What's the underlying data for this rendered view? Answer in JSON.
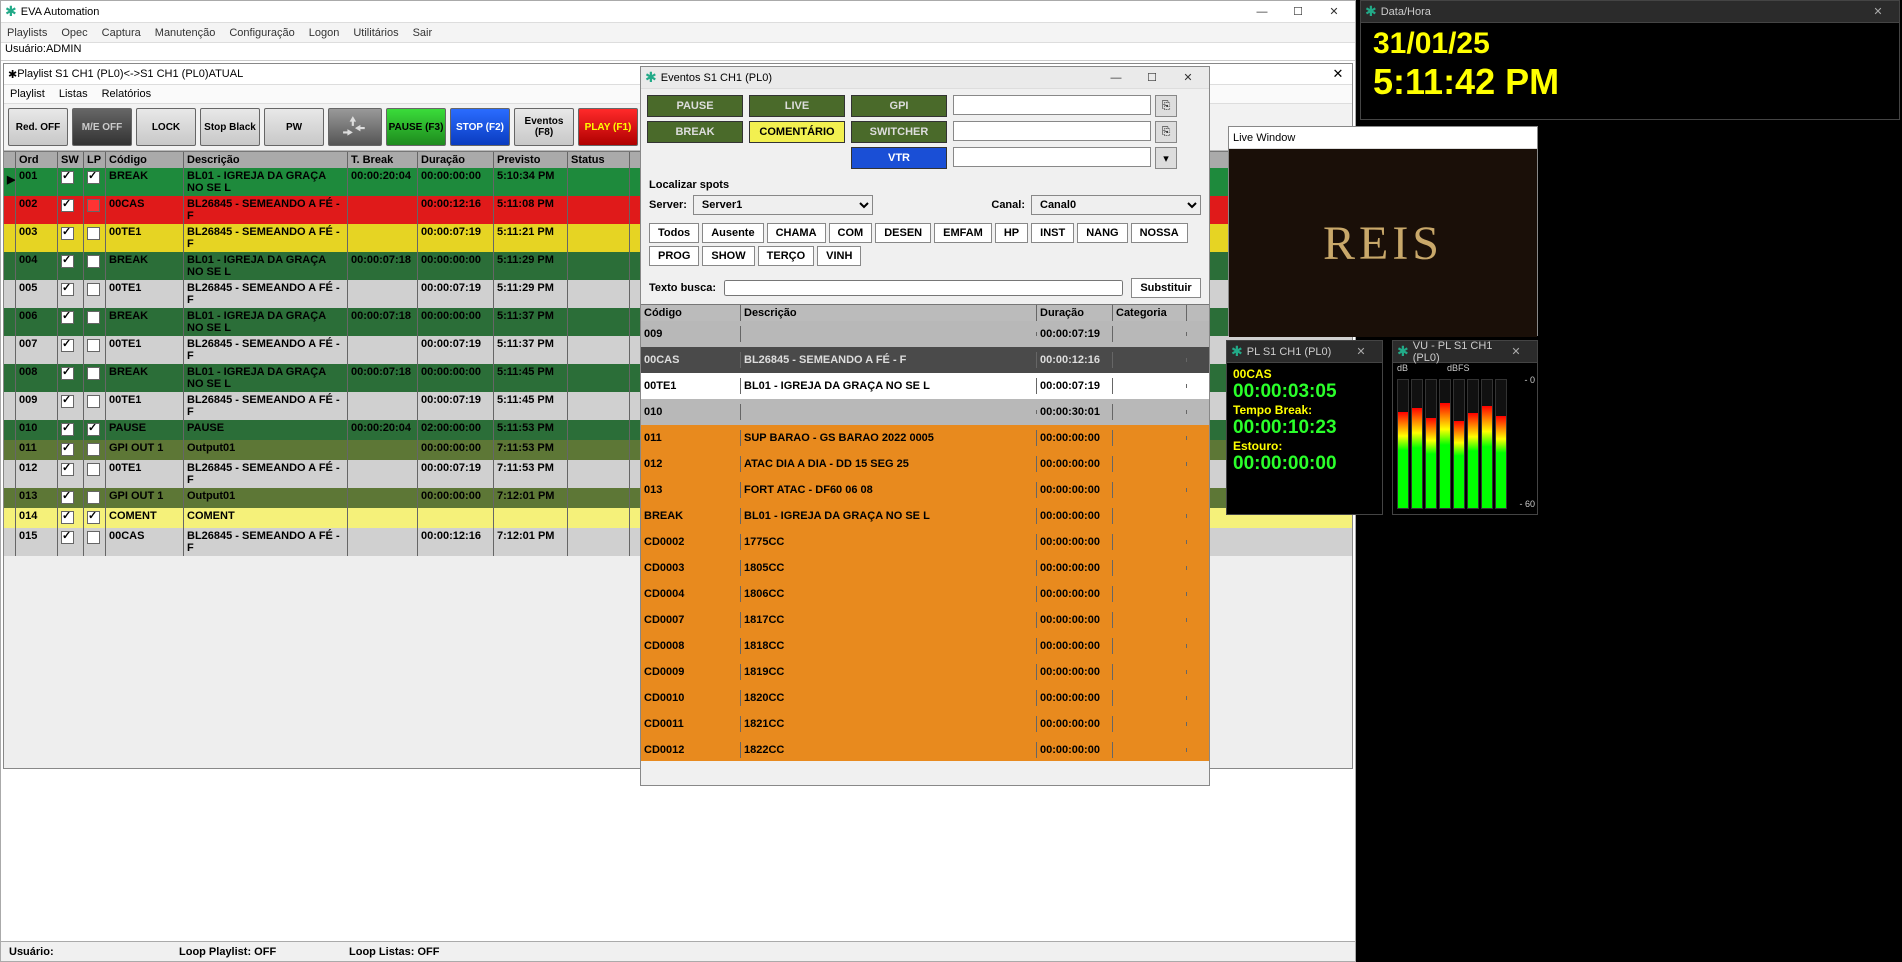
{
  "app": {
    "title": "EVA Automation",
    "menu": [
      "Playlists",
      "Opec",
      "Captura",
      "Manutenção",
      "Configuração",
      "Logon",
      "Utilitários",
      "Sair"
    ],
    "user_label": "Usuário:ADMIN"
  },
  "playlist_window": {
    "title": "Playlist S1 CH1 (PL0)<->S1 CH1 (PL0)ATUAL",
    "menu": [
      "Playlist",
      "Listas",
      "Relatórios"
    ],
    "buttons": {
      "red_off": "Red.\nOFF",
      "me_off": "M/E\nOFF",
      "lock": "LOCK",
      "stop_black": "Stop\nBlack",
      "pw": "PW",
      "pause": "PAUSE\n(F3)",
      "stop": "STOP\n(F2)",
      "eventos": "Eventos\n(F8)",
      "play": "PLAY\n(F1)"
    },
    "headers": {
      "ord": "Ord",
      "sw": "SW",
      "lp": "LP",
      "codigo": "Código",
      "descricao": "Descrição",
      "tbreak": "T. Break",
      "duracao": "Duração",
      "previsto": "Previsto",
      "status": "Status"
    },
    "rows": [
      {
        "ord": "001",
        "sw": true,
        "lp": true,
        "cod": "BREAK",
        "desc": "BL01 - IGREJA DA GRAÇA NO SE L",
        "tb": "00:00:20:04",
        "dur": "00:00:00:00",
        "prev": "5:10:34 PM",
        "cls": "rc-green",
        "h28": true
      },
      {
        "ord": "002",
        "sw": true,
        "lp": false,
        "cod": "00CAS",
        "desc": "BL26845 - SEMEANDO A FÉ - F",
        "tb": "",
        "dur": "00:00:12:16",
        "prev": "5:11:08 PM",
        "cls": "rc-red",
        "h28": true,
        "lpred": true
      },
      {
        "ord": "003",
        "sw": true,
        "lp": false,
        "cod": "00TE1",
        "desc": "BL26845 - SEMEANDO A FÉ - F",
        "tb": "",
        "dur": "00:00:07:19",
        "prev": "5:11:21 PM",
        "cls": "rc-yellow",
        "h28": true
      },
      {
        "ord": "004",
        "sw": true,
        "lp": false,
        "cod": "BREAK",
        "desc": "BL01 - IGREJA DA GRAÇA NO SE L",
        "tb": "00:00:07:18",
        "dur": "00:00:00:00",
        "prev": "5:11:29 PM",
        "cls": "rc-dgreen",
        "h28": true
      },
      {
        "ord": "005",
        "sw": true,
        "lp": false,
        "cod": "00TE1",
        "desc": "BL26845 - SEMEANDO A FÉ - F",
        "tb": "",
        "dur": "00:00:07:19",
        "prev": "5:11:29 PM",
        "cls": "rc-lgray",
        "h28": true
      },
      {
        "ord": "006",
        "sw": true,
        "lp": false,
        "cod": "BREAK",
        "desc": "BL01 - IGREJA DA GRAÇA NO SE L",
        "tb": "00:00:07:18",
        "dur": "00:00:00:00",
        "prev": "5:11:37 PM",
        "cls": "rc-dgreen",
        "h28": true
      },
      {
        "ord": "007",
        "sw": true,
        "lp": false,
        "cod": "00TE1",
        "desc": "BL26845 - SEMEANDO A FÉ - F",
        "tb": "",
        "dur": "00:00:07:19",
        "prev": "5:11:37 PM",
        "cls": "rc-lgray",
        "h28": true
      },
      {
        "ord": "008",
        "sw": true,
        "lp": false,
        "cod": "BREAK",
        "desc": "BL01 - IGREJA DA GRAÇA NO SE L",
        "tb": "00:00:07:18",
        "dur": "00:00:00:00",
        "prev": "5:11:45 PM",
        "cls": "rc-dgreen",
        "h28": true
      },
      {
        "ord": "009",
        "sw": true,
        "lp": false,
        "cod": "00TE1",
        "desc": "BL26845 - SEMEANDO A FÉ - F",
        "tb": "",
        "dur": "00:00:07:19",
        "prev": "5:11:45 PM",
        "cls": "rc-lgray",
        "h28": true
      },
      {
        "ord": "010",
        "sw": true,
        "lp": true,
        "cod": "PAUSE",
        "desc": "PAUSE",
        "tb": "00:00:20:04",
        "dur": "02:00:00:00",
        "prev": "5:11:53 PM",
        "cls": "rc-dgreen"
      },
      {
        "ord": "011",
        "sw": true,
        "lp": false,
        "cod": "GPI OUT 1",
        "desc": "Output01",
        "tb": "",
        "dur": "00:00:00:00",
        "prev": "7:11:53 PM",
        "cls": "rc-olive"
      },
      {
        "ord": "012",
        "sw": true,
        "lp": false,
        "cod": "00TE1",
        "desc": "BL26845 - SEMEANDO A FÉ - F",
        "tb": "",
        "dur": "00:00:07:19",
        "prev": "7:11:53 PM",
        "cls": "rc-lgray",
        "h28": true
      },
      {
        "ord": "013",
        "sw": true,
        "lp": false,
        "cod": "GPI OUT 1",
        "desc": "Output01",
        "tb": "",
        "dur": "00:00:00:00",
        "prev": "7:12:01 PM",
        "cls": "rc-olive"
      },
      {
        "ord": "014",
        "sw": true,
        "lp": true,
        "cod": "COMENT",
        "desc": "COMENT",
        "tb": "",
        "dur": "",
        "prev": "",
        "cls": "rc-lyellow"
      },
      {
        "ord": "015",
        "sw": true,
        "lp": false,
        "cod": "00CAS",
        "desc": "BL26845 - SEMEANDO A FÉ - F",
        "tb": "",
        "dur": "00:00:12:16",
        "prev": "7:12:01 PM",
        "cls": "rc-lgray",
        "h28": true
      }
    ],
    "status": {
      "usuario": "Usuário:",
      "loop_pl": "Loop Playlist: OFF",
      "loop_li": "Loop Listas: OFF"
    }
  },
  "eventos_window": {
    "title": "Eventos S1 CH1 (PL0)",
    "buttons": {
      "pause": "PAUSE",
      "live": "LIVE",
      "gpi": "GPI",
      "break": "BREAK",
      "coment": "COMENTÁRIO",
      "switcher": "SWITCHER",
      "vtr": "VTR"
    },
    "localizar": "Localizar spots",
    "server_lbl": "Server:",
    "server_val": "Server1",
    "canal_lbl": "Canal:",
    "canal_val": "Canal0",
    "cats": [
      "Todos",
      "Ausente",
      "CHAMA",
      "COM",
      "DESEN",
      "EMFAM",
      "HP",
      "INST",
      "NANG",
      "NOSSA",
      "PROG",
      "SHOW",
      "TERÇO",
      "VINH"
    ],
    "texto_lbl": "Texto busca:",
    "subst": "Substituir",
    "headers": {
      "cod": "Código",
      "desc": "Descrição",
      "dur": "Duração",
      "cat": "Categoria"
    },
    "rows": [
      {
        "cod": "009",
        "desc": "",
        "dur": "00:00:07:19",
        "cls": "er-gr"
      },
      {
        "cod": "00CAS",
        "desc": "BL26845 - SEMEANDO A FÉ - F",
        "dur": "00:00:12:16",
        "cls": "er-dk"
      },
      {
        "cod": "00TE1",
        "desc": "BL01 - IGREJA DA GRAÇA NO SE L",
        "dur": "00:00:07:19",
        "cls": "er-wh"
      },
      {
        "cod": "010",
        "desc": "",
        "dur": "00:00:30:01",
        "cls": "er-gr"
      },
      {
        "cod": "011",
        "desc": "SUP BARAO - GS BARAO 2022 0005",
        "dur": "00:00:00:00",
        "cls": "er-or"
      },
      {
        "cod": "012",
        "desc": "ATAC DIA A DIA - DD 15 SEG 25",
        "dur": "00:00:00:00",
        "cls": "er-or"
      },
      {
        "cod": "013",
        "desc": "FORT ATAC - DF60 06 08",
        "dur": "00:00:00:00",
        "cls": "er-or"
      },
      {
        "cod": "BREAK",
        "desc": "BL01 - IGREJA DA GRAÇA NO SE L",
        "dur": "00:00:00:00",
        "cls": "er-or"
      },
      {
        "cod": "CD0002",
        "desc": "1775CC",
        "dur": "00:00:00:00",
        "cls": "er-or"
      },
      {
        "cod": "CD0003",
        "desc": "1805CC",
        "dur": "00:00:00:00",
        "cls": "er-or"
      },
      {
        "cod": "CD0004",
        "desc": "1806CC",
        "dur": "00:00:00:00",
        "cls": "er-or"
      },
      {
        "cod": "CD0007",
        "desc": "1817CC",
        "dur": "00:00:00:00",
        "cls": "er-or"
      },
      {
        "cod": "CD0008",
        "desc": "1818CC",
        "dur": "00:00:00:00",
        "cls": "er-or"
      },
      {
        "cod": "CD0009",
        "desc": "1819CC",
        "dur": "00:00:00:00",
        "cls": "er-or"
      },
      {
        "cod": "CD0010",
        "desc": "1820CC",
        "dur": "00:00:00:00",
        "cls": "er-or"
      },
      {
        "cod": "CD0011",
        "desc": "1821CC",
        "dur": "00:00:00:00",
        "cls": "er-or"
      },
      {
        "cod": "CD0012",
        "desc": "1822CC",
        "dur": "00:00:00:00",
        "cls": "er-or"
      }
    ]
  },
  "datahora": {
    "title": "Data/Hora",
    "date": "31/01/25",
    "time": "5:11:42 PM"
  },
  "live": {
    "title": "Live Window",
    "text": "REIS"
  },
  "pl_panel": {
    "title": "PL S1 CH1 (PL0)",
    "code": "00CAS",
    "t1": "00:00:03:05",
    "lbl_tb": "Tempo Break:",
    "t2": "00:00:10:23",
    "lbl_es": "Estouro:",
    "t3": "00:00:00:00"
  },
  "vu": {
    "title": "VU - PL S1 CH1 (PL0)",
    "db": "dB",
    "dbfs": "dBFS",
    "zero": "- 0",
    "neg60": "- 60"
  }
}
